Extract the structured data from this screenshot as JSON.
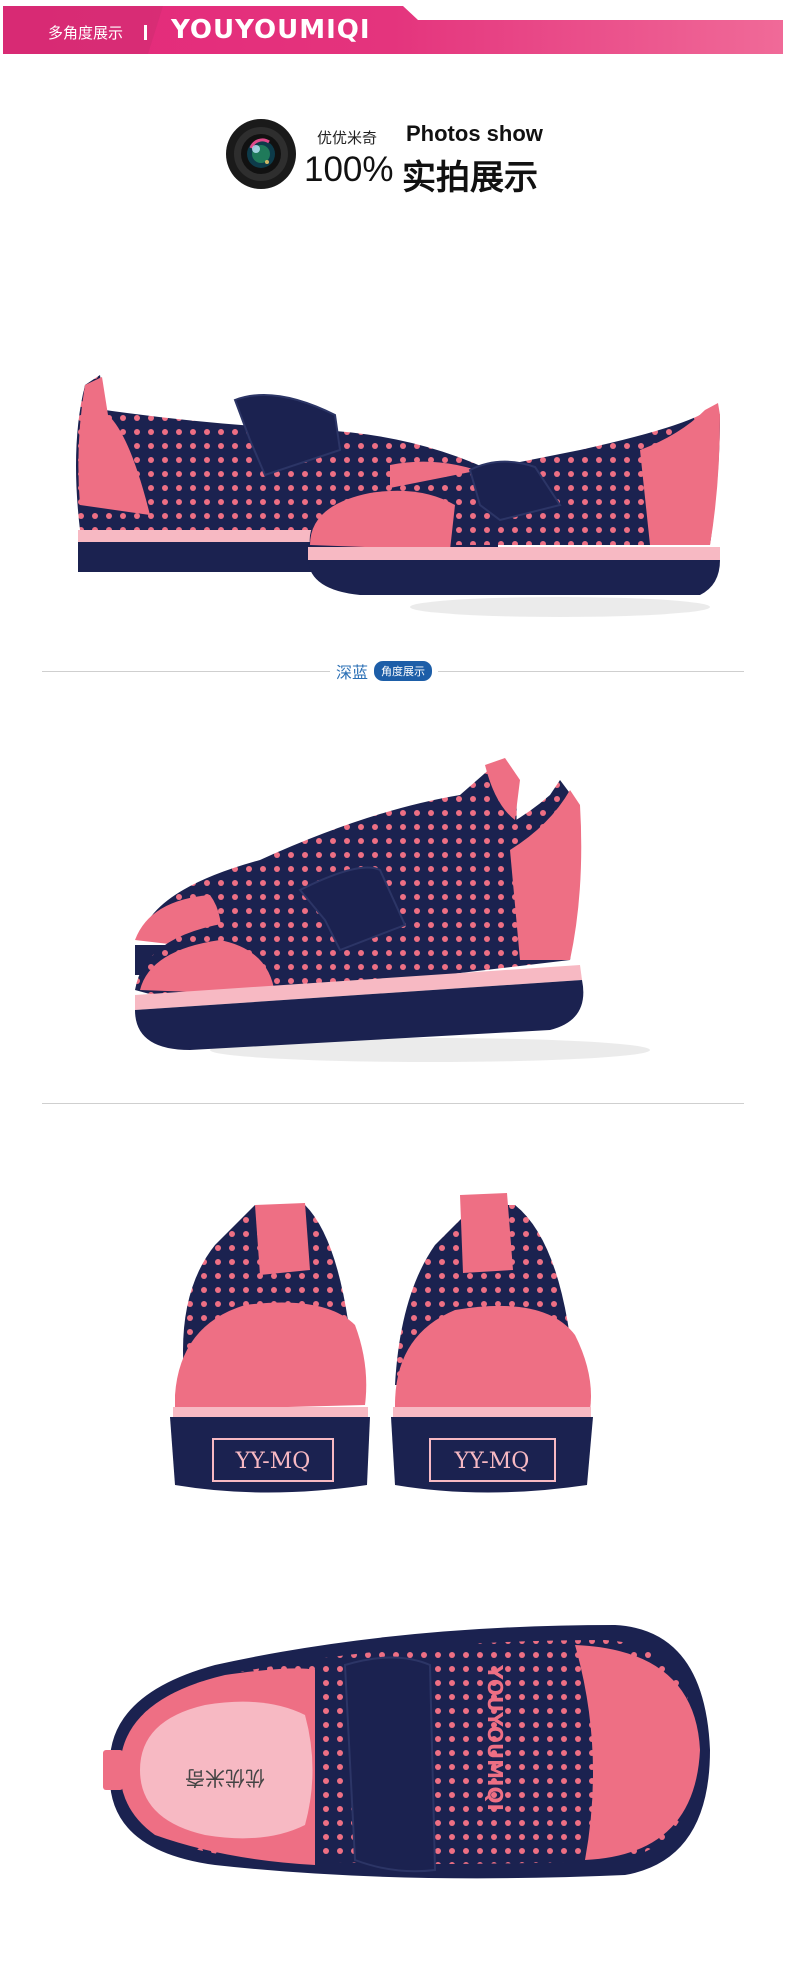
{
  "banner": {
    "section_label": "多角度展示",
    "brand": "YOUYOUMIQI",
    "gradient_start": "#e62e79",
    "gradient_end": "#f06a98"
  },
  "photo_header": {
    "brand_cn": "优优米奇",
    "title_en": "Photos show",
    "percent": "100%",
    "subtitle": "实拍展示",
    "icon": "camera-lens-icon"
  },
  "color_tag": {
    "name": "深蓝",
    "pill": "角度展示",
    "text_color": "#2a6fb5",
    "pill_color": "#1d5ea8"
  },
  "photos": {
    "heel_text": "YY-MQ",
    "strap_text": "YOUYOUMIQI",
    "insole_text": "优优米奇",
    "navy": "#1b2250",
    "pink": "#ee6f84",
    "light_pink": "#f7b9c3"
  }
}
